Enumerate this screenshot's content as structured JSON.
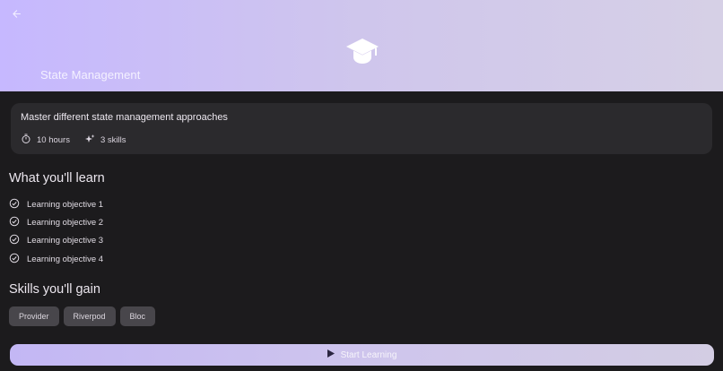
{
  "header": {
    "title": "State Management",
    "back_icon": "arrow-left-icon",
    "hero_icon": "graduation-cap-icon",
    "gradient_start": "#c6b8ff",
    "gradient_end": "#d6d0e6"
  },
  "info": {
    "description": "Master different state management approaches",
    "duration": "10 hours",
    "duration_icon": "timer-icon",
    "skills_count": "3 skills",
    "skills_icon": "sparkle-icon"
  },
  "learn": {
    "title": "What you'll learn",
    "objectives": [
      "Learning objective 1",
      "Learning objective 2",
      "Learning objective 3",
      "Learning objective 4"
    ]
  },
  "skills": {
    "title": "Skills you'll gain",
    "items": [
      "Provider",
      "Riverpod",
      "Bloc"
    ]
  },
  "cta": {
    "label": "Start Learning",
    "icon": "play-icon"
  },
  "colors": {
    "background": "#1c1b1d",
    "card": "#2b2a2d",
    "chip": "#48464b",
    "accent": "#c6b8ff"
  }
}
